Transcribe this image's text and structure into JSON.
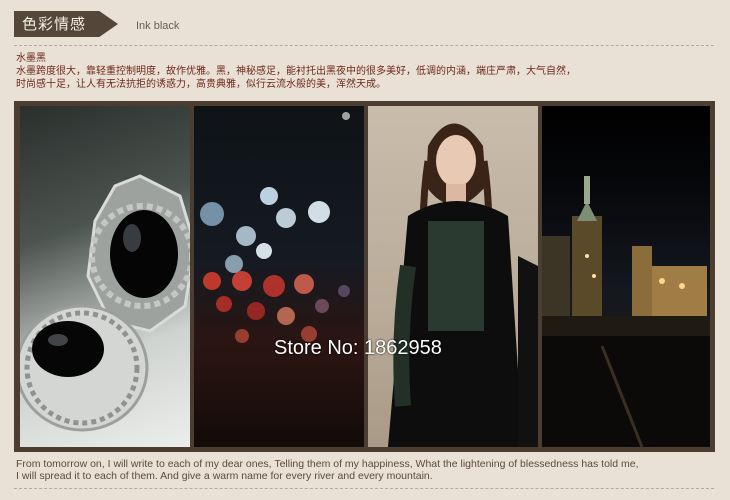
{
  "header": {
    "tag_label": "色彩情感",
    "subtitle": "Ink black"
  },
  "intro": {
    "title": "水墨黑",
    "line1": "水墨跨度很大，靠轻重控制明度，故作优雅。黑，神秘感足，能衬托出黑夜中的很多美好，低调的内涵，端庄严肃，大气自然，",
    "line2": "时尚感十足，让人有无法抗拒的诱惑力，高贵典雅，似行云流水般的美，浑然天成。"
  },
  "watermark": "Store No: 1862958",
  "footer": {
    "line1": "From tomorrow on, I will write to each of my dear ones, Telling them of my happiness, What the lightening of blessedness has told me,",
    "line2": "I will spread it to each of them. And give a warm name for every river and every mountain."
  }
}
